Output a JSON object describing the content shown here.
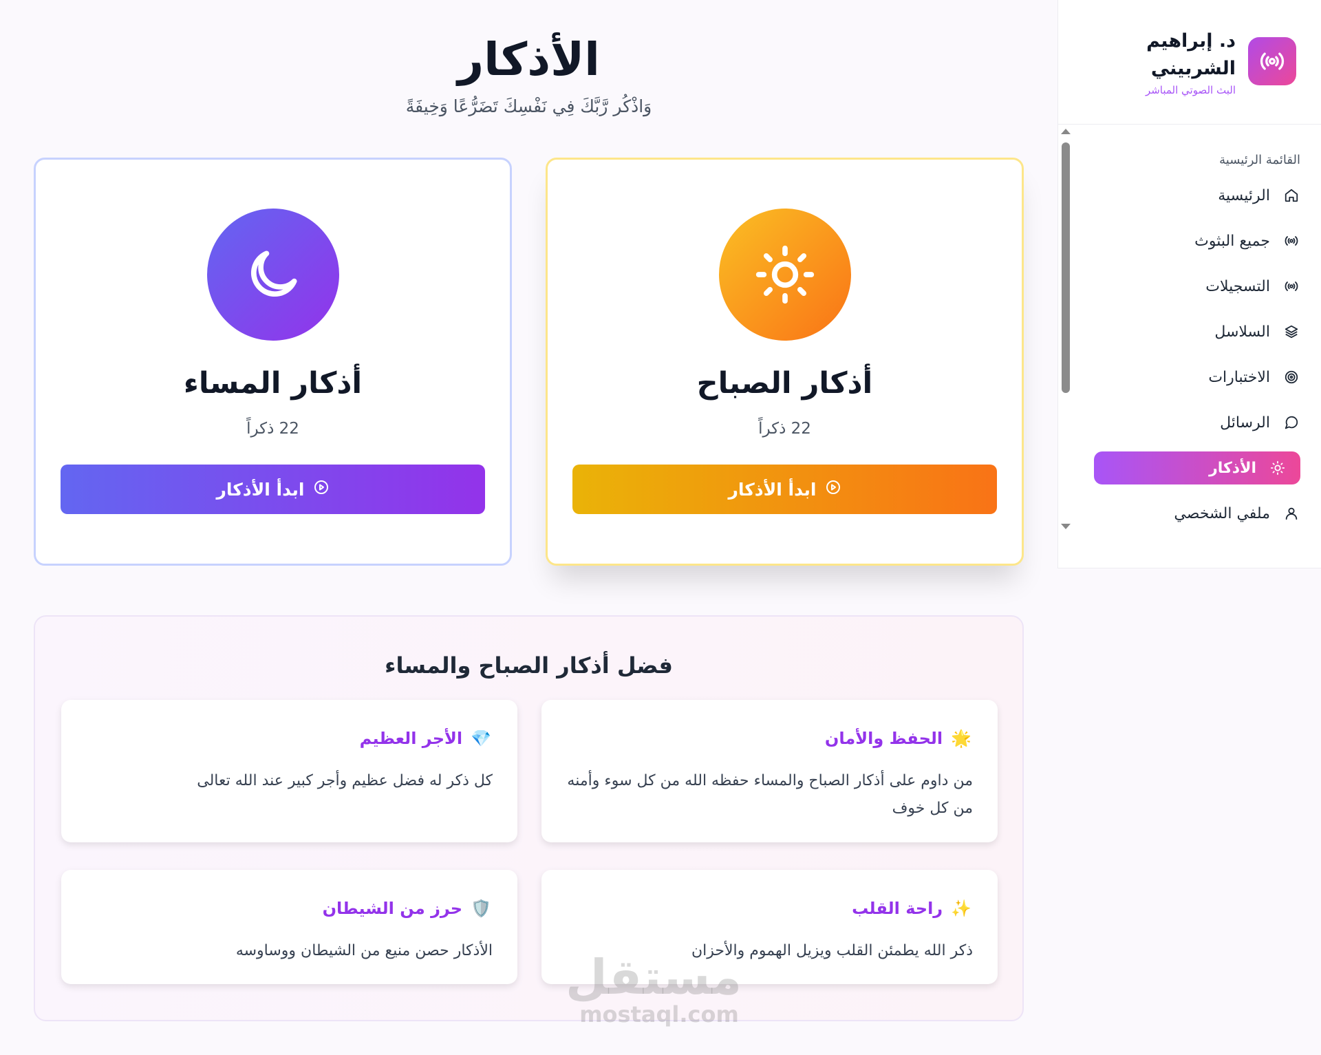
{
  "brand": {
    "name": "د. إبراهيم الشربيني",
    "subtitle": "البث الصوتي المباشر",
    "logo_icon": "broadcast-icon"
  },
  "sidebar": {
    "section_label": "القائمة الرئيسية",
    "items": [
      {
        "label": "الرئيسية",
        "icon": "home-icon",
        "active": false
      },
      {
        "label": "جميع البثوث",
        "icon": "broadcast-icon",
        "active": false
      },
      {
        "label": "التسجيلات",
        "icon": "broadcast-icon",
        "active": false
      },
      {
        "label": "السلاسل",
        "icon": "layers-icon",
        "active": false
      },
      {
        "label": "الاختبارات",
        "icon": "target-icon",
        "active": false
      },
      {
        "label": "الرسائل",
        "icon": "message-icon",
        "active": false
      },
      {
        "label": "الأذكار",
        "icon": "sun-icon",
        "active": true
      },
      {
        "label": "ملفي الشخصي",
        "icon": "user-icon",
        "active": false
      }
    ]
  },
  "header": {
    "title": "الأذكار",
    "subtitle": "وَاذْكُر رَّبَّكَ فِي نَفْسِكَ تَضَرُّعًا وَخِيفَةً"
  },
  "cards": {
    "morning": {
      "title": "أذكار الصباح",
      "count": "22 ذكراً",
      "button": "ابدأ الأذكار",
      "icon": "sun-icon"
    },
    "evening": {
      "title": "أذكار المساء",
      "count": "22 ذكراً",
      "button": "ابدأ الأذكار",
      "icon": "moon-icon"
    }
  },
  "virtues": {
    "title": "فضل أذكار الصباح والمساء",
    "items": [
      {
        "emoji": "🌟",
        "title": "الحفظ والأمان",
        "text": "من داوم على أذكار الصباح والمساء حفظه الله من كل سوء وأمنه من كل خوف"
      },
      {
        "emoji": "💎",
        "title": "الأجر العظيم",
        "text": "كل ذكر له فضل عظيم وأجر كبير عند الله تعالى"
      },
      {
        "emoji": "✨",
        "title": "راحة القلب",
        "text": "ذكر الله يطمئن القلب ويزيل الهموم والأحزان"
      },
      {
        "emoji": "🛡️",
        "title": "حرز من الشيطان",
        "text": "الأذكار حصن منيع من الشيطان ووساوسه"
      }
    ]
  },
  "watermark": {
    "arabic": "مستقل",
    "latin": "mostaql.com"
  },
  "colors": {
    "accent_purple": "#9333ea",
    "accent_pink": "#ec4899",
    "morning_gradient_start": "#eab308",
    "morning_gradient_end": "#f97316",
    "evening_gradient_start": "#6366f1",
    "evening_gradient_end": "#9333ea"
  }
}
